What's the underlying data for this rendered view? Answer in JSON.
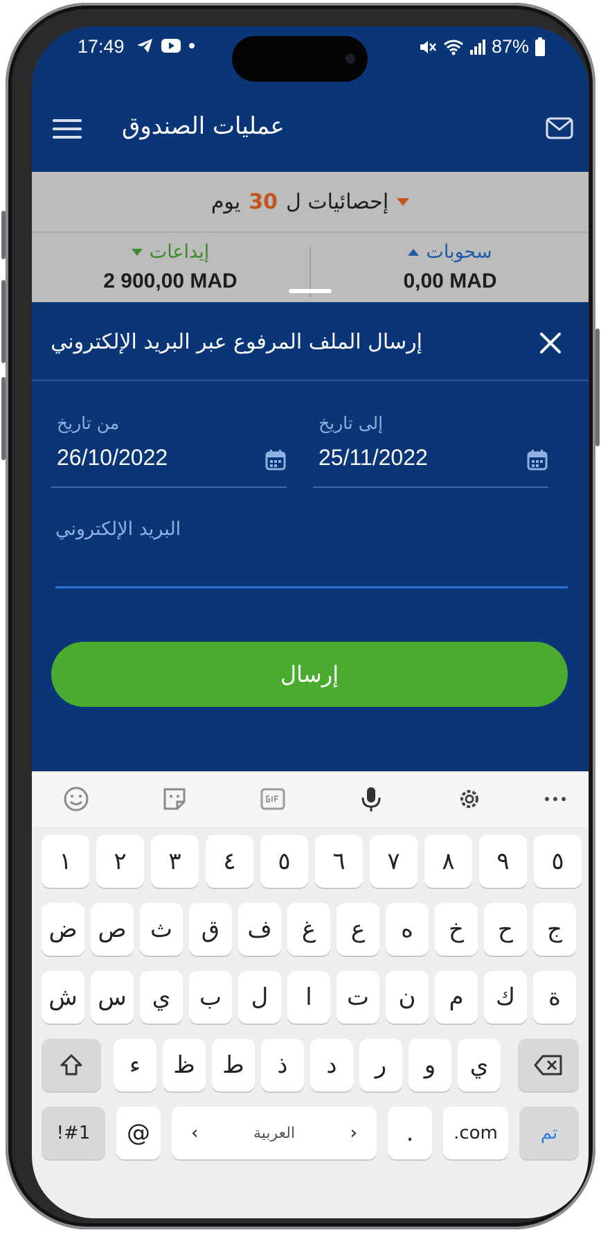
{
  "status_bar": {
    "time": "17:49",
    "battery": "87%"
  },
  "app_bar": {
    "title": "عمليات الصندوق"
  },
  "stats": {
    "prefix": "إحصائيات ل",
    "days": "30",
    "suffix": "يوم",
    "deposits_label": "إيداعات",
    "deposits_amount": "2 900,00 MAD",
    "withdrawals_label": "سحوبات",
    "withdrawals_amount": "0,00 MAD"
  },
  "sheet": {
    "title": "إرسال الملف المرفوع عبر البريد الإلكتروني",
    "from_label": "من تاريخ",
    "from_value": "26/10/2022",
    "to_label": "إلى تاريخ",
    "to_value": "25/11/2022",
    "email_placeholder": "البريد الإلكتروني",
    "email_value": "",
    "send_label": "إرسال"
  },
  "keyboard": {
    "row1": [
      "١",
      "٢",
      "٣",
      "٤",
      "٥",
      "٦",
      "٧",
      "٨",
      "٩",
      "٥"
    ],
    "row2": [
      "ض",
      "ص",
      "ث",
      "ق",
      "ف",
      "غ",
      "ع",
      "ه",
      "خ",
      "ح",
      "ج"
    ],
    "row3": [
      "ش",
      "س",
      "ي",
      "ب",
      "ل",
      "ا",
      "ت",
      "ن",
      "م",
      "ك",
      "ة"
    ],
    "row4": [
      "ء",
      "ظ",
      "ط",
      "ذ",
      "د",
      "ر",
      "و",
      "ي"
    ],
    "symbols_key": "!#1",
    "at_key": "@",
    "space_label": "العربية",
    "period_key": ".",
    "com_key": ".com",
    "done_key": "تم"
  },
  "colors": {
    "primary": "#0a3677",
    "accent_green": "#4aac2e",
    "accent_orange": "#c2561a"
  }
}
